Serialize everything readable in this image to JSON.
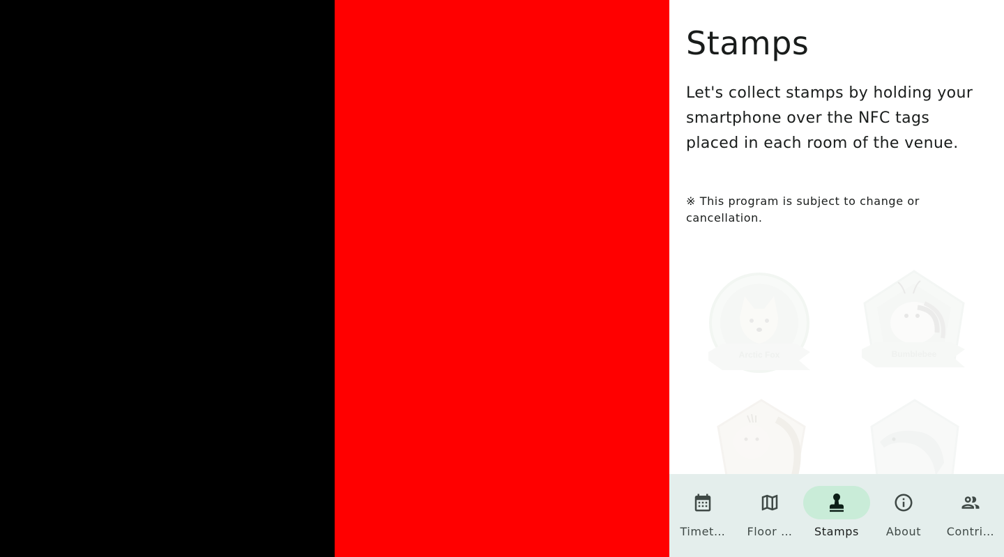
{
  "screen": {
    "title": "Stamps",
    "description": "Let's collect stamps by holding your smartphone over the NFC tags placed in each room of the venue.",
    "note": "※ This program is subject to change or cancellation."
  },
  "stamps": [
    {
      "label": "Arctic Fox",
      "icon": "arctic-fox-stamp"
    },
    {
      "label": "Bumblebee",
      "icon": "bumblebee-stamp"
    },
    {
      "label": "",
      "icon": "chipmunk-stamp"
    },
    {
      "label": "",
      "icon": "dolphin-stamp"
    }
  ],
  "bottom_nav": {
    "items": [
      {
        "label": "Timet…",
        "icon": "calendar-icon",
        "active": false
      },
      {
        "label": "Floor …",
        "icon": "map-icon",
        "active": false
      },
      {
        "label": "Stamps",
        "icon": "stamp-icon",
        "active": true
      },
      {
        "label": "About",
        "icon": "info-icon",
        "active": false
      },
      {
        "label": "Contri…",
        "icon": "people-icon",
        "active": false
      }
    ]
  },
  "colors": {
    "nav_background": "#e4eeec",
    "nav_active_indicator": "#c9ecd8",
    "left_panel": "#000000",
    "middle_panel": "#ff0000"
  }
}
